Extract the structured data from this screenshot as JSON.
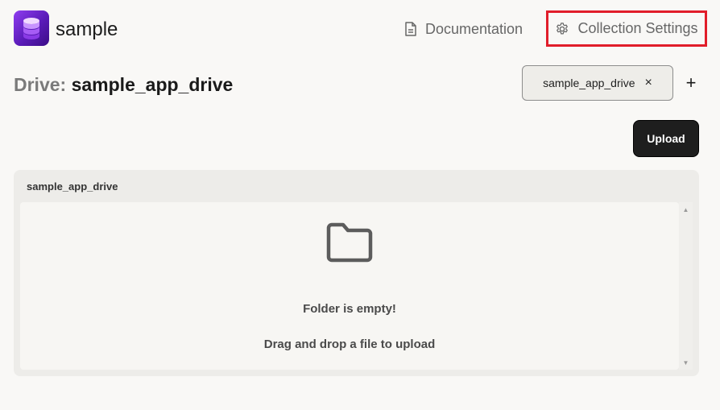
{
  "header": {
    "app_name": "sample",
    "documentation_label": "Documentation",
    "collection_settings_label": "Collection Settings"
  },
  "drive": {
    "title_prefix": "Drive:",
    "title_name": "sample_app_drive",
    "chip_label": "sample_app_drive",
    "chip_close": "×",
    "add_label": "+",
    "upload_label": "Upload"
  },
  "panel": {
    "title": "sample_app_drive",
    "empty_title": "Folder is empty!",
    "empty_subtitle": "Drag and drop a file to upload"
  },
  "icons": {
    "logo": "database-icon",
    "documentation": "document-icon",
    "settings": "gear-icon",
    "empty": "folder-icon"
  },
  "colors": {
    "highlight_border": "#e11d2a",
    "logo_purple": "#7a2be0",
    "upload_bg": "#1e1e1e"
  }
}
